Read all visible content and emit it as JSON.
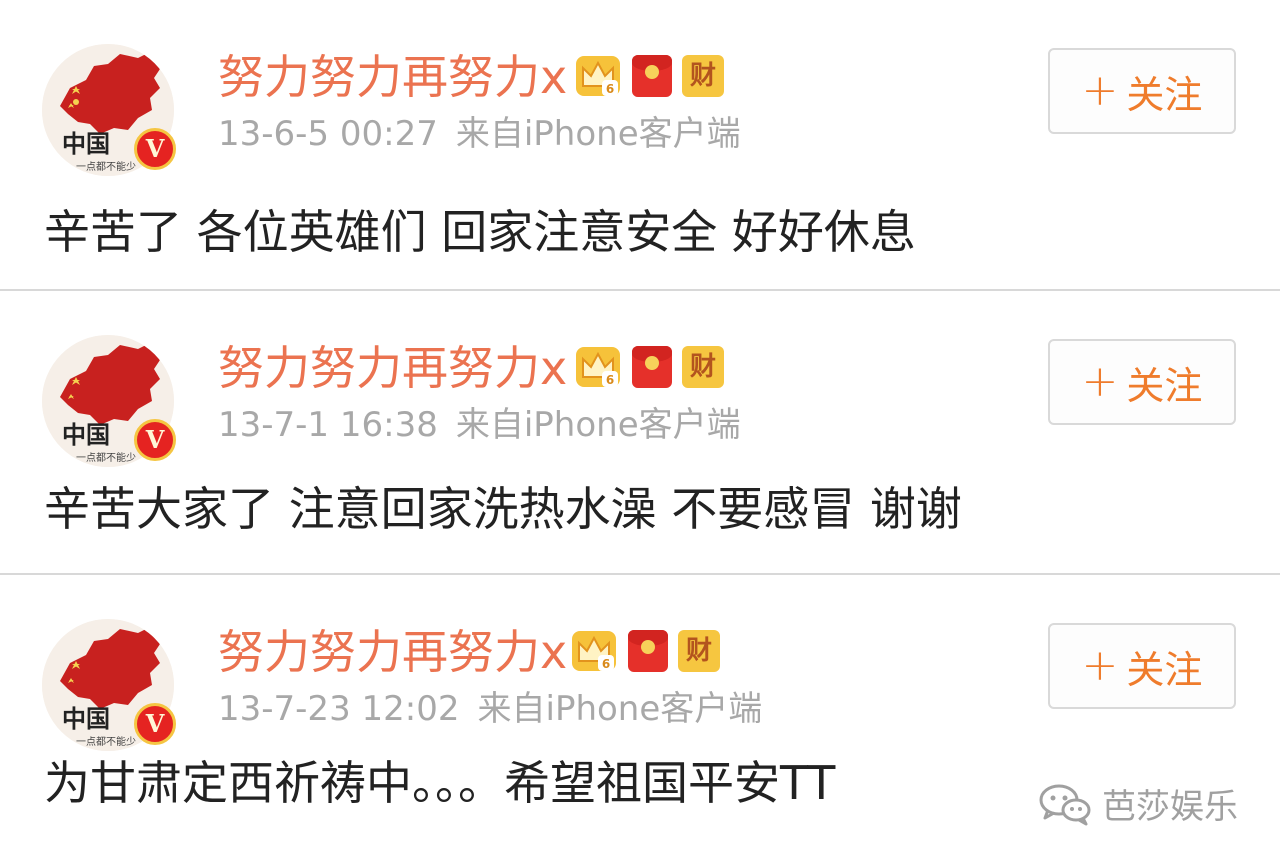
{
  "posts": [
    {
      "username": "努力努力再努力x",
      "timestamp": "13-6-5 00:27",
      "source": "来自iPhone客户端",
      "text": "辛苦了 各位英雄们 回家注意安全 好好休息",
      "follow_label": "关注"
    },
    {
      "username": "努力努力再努力x",
      "timestamp": "13-7-1 16:38",
      "source": "来自iPhone客户端",
      "text": "辛苦大家了 注意回家洗热水澡 不要感冒 谢谢",
      "follow_label": "关注"
    },
    {
      "username": "努力努力再努力x",
      "timestamp": "13-7-23 12:02",
      "source": "来自iPhone客户端",
      "text": "为甘肃定西祈祷中。。。希望祖国平安TT",
      "follow_label": "关注"
    }
  ],
  "badges": {
    "crown_level": "6",
    "cai": "财",
    "verified": "V"
  },
  "avatar": {
    "text": "中国",
    "subtext": "一点都不能少"
  },
  "watermark": {
    "text": "芭莎娱乐"
  },
  "icons": {
    "follow": "plus-icon",
    "crown": "crown-icon",
    "red_packet": "red-packet-icon",
    "wealth": "wealth-badge-icon",
    "verified": "verified-v-icon",
    "watermark": "wechat-icon"
  },
  "colors": {
    "username": "#eb7350",
    "meta": "#a8a8a8",
    "follow": "#ef7c2c",
    "body_text": "#222222",
    "verified_bg": "#e52321",
    "divider": "#d8d8d8"
  }
}
